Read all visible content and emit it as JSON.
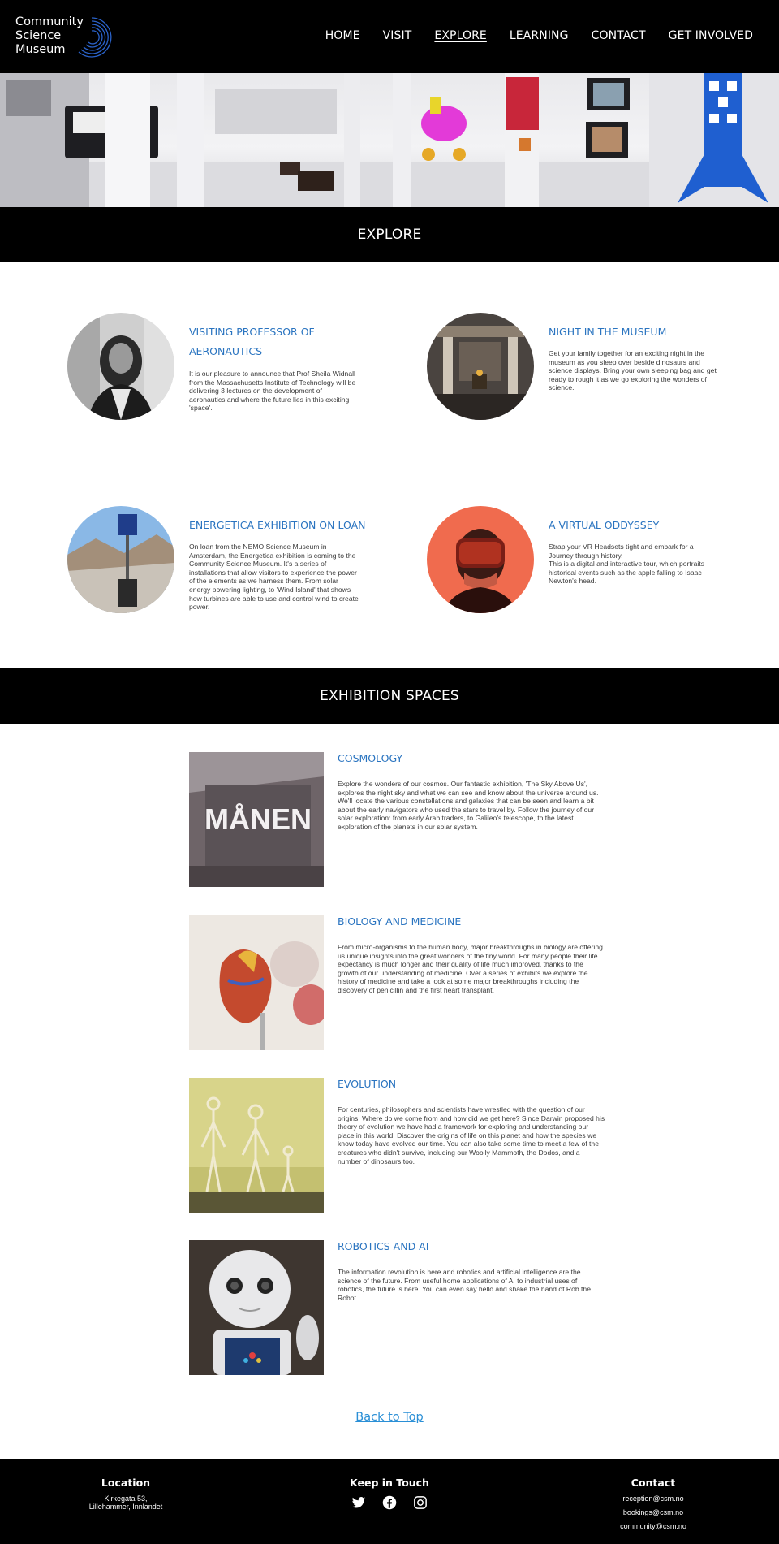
{
  "brand": {
    "name_line1": "Community",
    "name_line2": "Science",
    "name_line3": "Museum"
  },
  "nav": [
    {
      "label": "HOME"
    },
    {
      "label": "VISIT"
    },
    {
      "label": "EXPLORE",
      "active": true
    },
    {
      "label": "LEARNING"
    },
    {
      "label": "CONTACT"
    },
    {
      "label": "GET INVOLVED"
    }
  ],
  "explore_bar": {
    "title": "EXPLORE"
  },
  "events": [
    {
      "title": "VISITING PROFESSOR OF AERONAUTICS",
      "description": "It is our pleasure to announce that Prof Sheila Widnall from the Massachusetts Institute of Technology will be delivering 3 lectures on the development of aeronautics and where the future lies in this exciting 'space'.",
      "image": "professor-portrait"
    },
    {
      "title": "NIGHT IN THE MUSEUM",
      "description": "Get your family together for an exciting night in the museum as you sleep over beside dinosaurs and science displays. Bring your own sleeping bag and get ready to rough it as we go exploring the wonders of science.",
      "image": "museum-hall"
    },
    {
      "title": "ENERGETICA EXHIBITION ON LOAN",
      "description": "On loan from the NEMO Science Museum in Amsterdam, the Energetica exhibition is coming to the Community Science Museum. It's a series of installations that allow visitors to experience the power of the elements as we harness them. From solar energy powering lighting, to 'Wind Island' that shows how turbines are able to use and control wind to create power.",
      "image": "solar-panel"
    },
    {
      "title": "A VIRTUAL ODDYSSEY",
      "description": "Strap your VR Headsets tight and embark for a Journey through history.\nThis is a digital and interactive tour, which portraits historical events such as the apple falling to Isaac Newton's head.",
      "image": "vr-headset"
    }
  ],
  "spaces_bar": {
    "title": "EXHIBITION SPACES"
  },
  "spaces": [
    {
      "title": "COSMOLOGY",
      "description": "Explore the wonders of our cosmos. Our fantastic exhibition, 'The Sky Above Us', explores the night sky and what we can see and know about the universe around us. We'll locate the various constellations and galaxies that can be seen and learn a bit about the early navigators who used the stars to travel by. Follow the journey of our solar exploration: from early Arab traders, to Galileo's telescope, to the latest exploration of the planets in our solar system.",
      "image_text": "MÅNEN"
    },
    {
      "title": "BIOLOGY AND MEDICINE",
      "description": "From micro-organisms to the human body, major breakthroughs in biology are offering us unique insights into the great wonders of the tiny world. For many people their life expectancy is much longer and their quality of life much improved, thanks to the growth of our understanding of medicine. Over a series of exhibits we explore the history of medicine and take a look at some major breakthroughs including the discovery of penicillin and the first heart transplant."
    },
    {
      "title": "EVOLUTION",
      "description": "For centuries, philosophers and scientists have wrestled with the question of our origins. Where do we come from and how did we get here? Since Darwin proposed his theory of evolution we have had a framework for exploring and understanding our place in this world. Discover the origins of life on this planet and how the species we know today have evolved our time. You can also take some time to meet a few of the creatures who didn't survive, including our Woolly Mammoth, the Dodos, and a number of dinosaurs too."
    },
    {
      "title": "ROBOTICS AND AI",
      "description": "The information revolution is here and robotics and artificial intelligence are the science of the future. From useful home applications of AI to industrial uses of robotics, the future is here. You can even say hello and shake the hand of Rob the Robot."
    }
  ],
  "back_to_top": "Back to Top",
  "footer": {
    "location_heading": "Location",
    "address_line1": "Kirkegata 53,",
    "address_line2": "Lillehammer, Innlandet",
    "touch_heading": "Keep in Touch",
    "social_icons": [
      "twitter-icon",
      "facebook-icon",
      "instagram-icon"
    ],
    "contact_heading": "Contact",
    "emails": [
      "reception@csm.no",
      "bookings@csm.no",
      "community@csm.no"
    ]
  },
  "colors": {
    "accent": "#2a74c0",
    "link": "#2a8fd6",
    "bar": "#000000"
  }
}
